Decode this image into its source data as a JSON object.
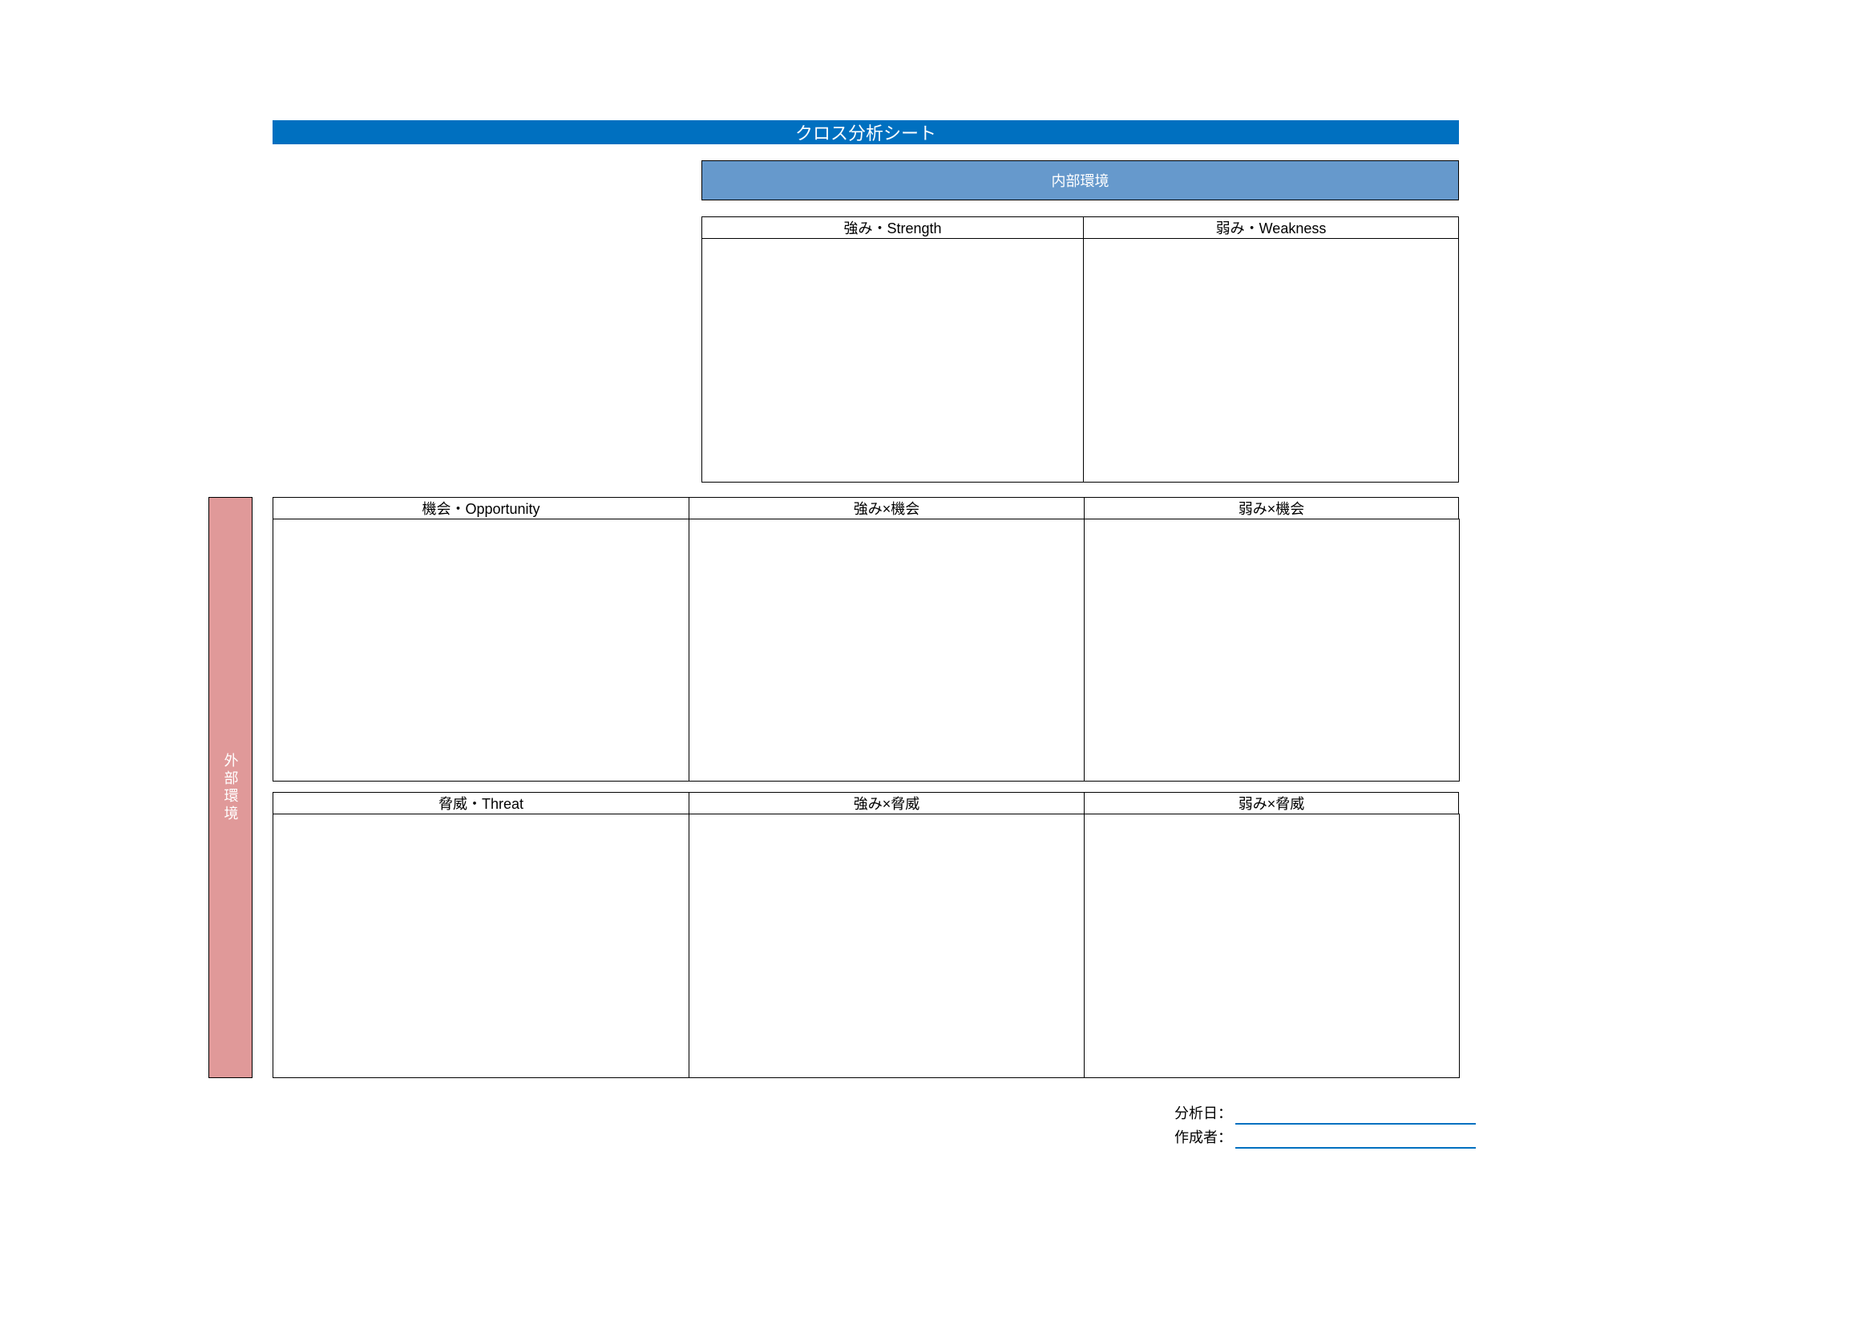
{
  "title": "クロス分析シート",
  "axes": {
    "internal": "内部環境",
    "external": "外部環境"
  },
  "headers": {
    "strength": "強み・Strength",
    "weakness": "弱み・Weakness",
    "opportunity": "機会・Opportunity",
    "threat": "脅威・Threat",
    "so": "強み×機会",
    "wo": "弱み×機会",
    "st": "強み×脅威",
    "wt": "弱み×脅威"
  },
  "cells": {
    "strength": "",
    "weakness": "",
    "opportunity": "",
    "threat": "",
    "so": "",
    "wo": "",
    "st": "",
    "wt": ""
  },
  "footer": {
    "date_label": "分析日：",
    "author_label": "作成者：",
    "date_value": "",
    "author_value": ""
  }
}
